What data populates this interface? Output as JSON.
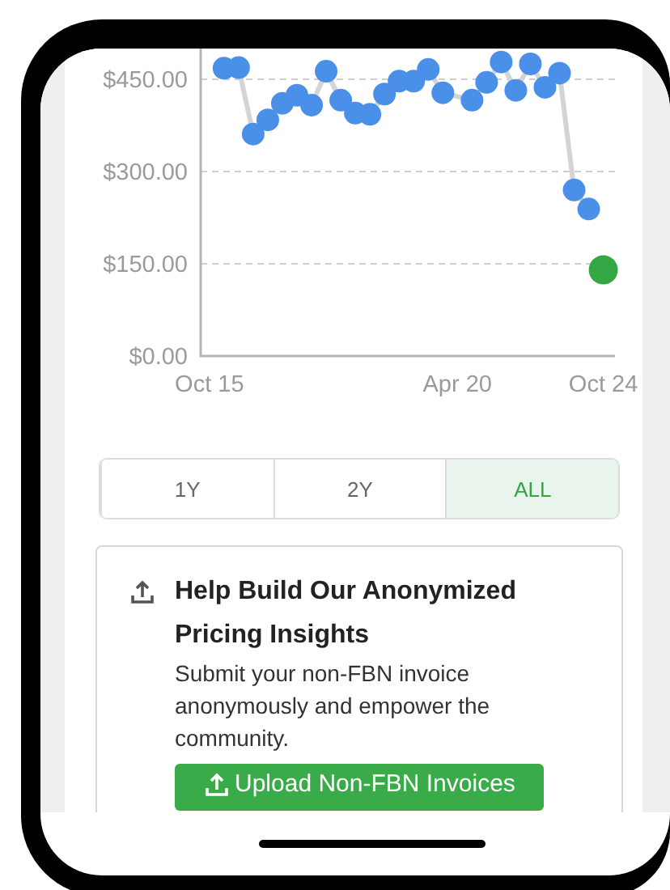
{
  "chart": {
    "chart_data": {
      "type": "line",
      "categories": [
        "Oct 15",
        null,
        null,
        null,
        null,
        null,
        null,
        null,
        null,
        null,
        null,
        null,
        null,
        null,
        null,
        null,
        null,
        "Apr 20",
        null,
        null,
        null,
        null,
        null,
        null,
        null,
        null,
        null,
        "Oct 24"
      ],
      "ylim": [
        0,
        500
      ],
      "grid": true,
      "yticks": [
        {
          "value": 0,
          "label": "$0.00"
        },
        {
          "value": 150,
          "label": "$150.00"
        },
        {
          "value": 300,
          "label": "$300.00"
        },
        {
          "value": 450,
          "label": "$450.00"
        }
      ],
      "series": [
        {
          "color": "#4a8fe8",
          "marker": true,
          "values": [
            null,
            468,
            469,
            361,
            384,
            411,
            424,
            408,
            463,
            416,
            395,
            393,
            426,
            447,
            447,
            466,
            428,
            null,
            416,
            445,
            478,
            432,
            475,
            437,
            460,
            270,
            239,
            null
          ]
        },
        {
          "color": "#34a745",
          "marker": true,
          "values": [
            null,
            null,
            null,
            null,
            null,
            null,
            null,
            null,
            null,
            null,
            null,
            null,
            null,
            null,
            null,
            null,
            null,
            null,
            null,
            null,
            null,
            null,
            null,
            null,
            null,
            null,
            null,
            140
          ]
        }
      ]
    }
  },
  "ranges": [
    {
      "label": "1Y",
      "selected": false
    },
    {
      "label": "2Y",
      "selected": false
    },
    {
      "label": "ALL",
      "selected": true
    }
  ],
  "card": {
    "title": "Help Build Our Anonymized Pricing Insights",
    "text": "Submit your non-FBN invoice anonymously and empower the community.",
    "button": "Upload Non-FBN Invoices"
  }
}
